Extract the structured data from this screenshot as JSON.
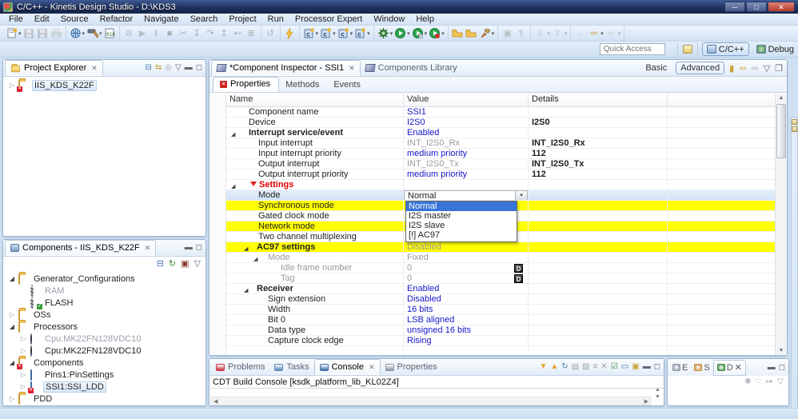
{
  "window": {
    "title": "C/C++ - Kinetis Design Studio - D:\\KDS3"
  },
  "menu": {
    "items": [
      "File",
      "Edit",
      "Source",
      "Refactor",
      "Navigate",
      "Search",
      "Project",
      "Run",
      "Processor Expert",
      "Window",
      "Help"
    ]
  },
  "toolbar": {
    "groups": [
      [
        {
          "n": "new-wizard",
          "dd": 1
        },
        {
          "n": "save",
          "dis": 1
        },
        {
          "n": "save-all",
          "dis": 1
        },
        {
          "n": "print",
          "dis": 1
        }
      ],
      [
        {
          "n": "debug-configurations",
          "dd": 1
        },
        {
          "n": "build",
          "dd": 1
        },
        {
          "n": "binary-utility"
        }
      ],
      [
        {
          "n": "skip-all-breakpoints",
          "dis": 1
        },
        {
          "n": "resume",
          "dis": 1
        },
        {
          "n": "suspend",
          "dis": 1
        },
        {
          "n": "terminate",
          "dis": 1
        },
        {
          "n": "disconnect",
          "dis": 1
        },
        {
          "n": "step-into",
          "dis": 1
        },
        {
          "n": "step-over",
          "dis": 1
        },
        {
          "n": "step-return",
          "dis": 1
        },
        {
          "n": "drop-to-frame",
          "dis": 1
        },
        {
          "n": "instruction-stepping",
          "dis": 1
        }
      ],
      [
        {
          "n": "restart",
          "dis": 1
        }
      ],
      [
        {
          "n": "flash-programmer"
        }
      ],
      [
        {
          "n": "new-connection",
          "dd": 1
        },
        {
          "n": "new-project",
          "dd": 1
        },
        {
          "n": "new-c-file",
          "dd": 1
        },
        {
          "n": "new-class",
          "dd": 1
        }
      ],
      [
        {
          "n": "debug",
          "dd": 1
        },
        {
          "n": "run",
          "dd": 1
        },
        {
          "n": "run-history",
          "dd": 1
        },
        {
          "n": "profile",
          "dd": 1
        }
      ],
      [
        {
          "n": "open-project"
        },
        {
          "n": "open-folder"
        },
        {
          "n": "search-toolbar",
          "dd": 1
        }
      ],
      [
        {
          "n": "mark-occurrences",
          "dis": 1
        },
        {
          "n": "show-whitespace",
          "dis": 1
        }
      ],
      [
        {
          "n": "next-annotation",
          "dis": 1,
          "dd": 1
        },
        {
          "n": "previous-annotation",
          "dis": 1,
          "dd": 1
        }
      ],
      [
        {
          "n": "last-edit-location",
          "dis": 1
        },
        {
          "n": "back",
          "dd": 1
        },
        {
          "n": "forward",
          "dis": 1,
          "dd": 1
        }
      ]
    ]
  },
  "quick_access": {
    "placeholder": "Quick Access"
  },
  "perspectives": {
    "items": [
      {
        "label": "C/C++",
        "active": true
      },
      {
        "label": "Debug",
        "active": false
      }
    ]
  },
  "project_explorer": {
    "title": "Project Explorer",
    "tree": [
      {
        "label": "IIS_KDS_K22F",
        "icon": "project",
        "level": 0,
        "arrow": "col",
        "selected": true
      }
    ]
  },
  "components_view": {
    "title": "Components - IIS_KDS_K22F",
    "tree": [
      {
        "label": "Generator_Configurations",
        "icon": "folder",
        "level": 0,
        "arrow": "exp"
      },
      {
        "label": "RAM",
        "icon": "gear",
        "level": 1,
        "gray": true
      },
      {
        "label": "FLASH",
        "icon": "gear-ok",
        "level": 1
      },
      {
        "label": "OSs",
        "icon": "folder",
        "level": 0,
        "arrow": "col"
      },
      {
        "label": "Processors",
        "icon": "folder",
        "level": 0,
        "arrow": "exp"
      },
      {
        "label": "Cpu:MK22FN128VDC10",
        "icon": "cpu",
        "level": 1,
        "arrow": "col",
        "gray": true
      },
      {
        "label": "Cpu:MK22FN128VDC10",
        "icon": "cpu",
        "level": 1,
        "arrow": "col"
      },
      {
        "label": "Components",
        "icon": "folder-err",
        "level": 0,
        "arrow": "exp"
      },
      {
        "label": "Pins1:PinSettings",
        "icon": "chip",
        "level": 1,
        "arrow": "col"
      },
      {
        "label": "SSI1:SSI_LDD",
        "icon": "chip-err",
        "level": 1,
        "arrow": "col",
        "selected": true
      },
      {
        "label": "PDD",
        "icon": "folder",
        "level": 0,
        "arrow": "col"
      }
    ]
  },
  "inspector": {
    "tab_label": "*Component Inspector - SSI1",
    "library_tab_label": "Components Library",
    "view_modes": [
      {
        "label": "Basic",
        "active": false
      },
      {
        "label": "Advanced",
        "active": true
      }
    ],
    "subtabs": [
      {
        "label": "Properties",
        "active": true,
        "error": true
      },
      {
        "label": "Methods"
      },
      {
        "label": "Events"
      }
    ],
    "columns": [
      "Name",
      "Value",
      "Details"
    ],
    "rows": [
      {
        "name": "Component name",
        "indent": 28,
        "value": "SSI1",
        "vstyle": "link"
      },
      {
        "name": "Device",
        "indent": 28,
        "value": "I2S0",
        "vstyle": "link",
        "details": "I2S0"
      },
      {
        "name": "Interrupt service/event",
        "indent": 28,
        "arrow": 6,
        "bold": true,
        "value": "Enabled",
        "vstyle": "link"
      },
      {
        "name": "Input interrupt",
        "indent": 40,
        "value": "INT_I2S0_Rx",
        "vstyle": "gray",
        "details": "INT_I2S0_Rx"
      },
      {
        "name": "Input interrupt priority",
        "indent": 40,
        "value": "medium priority",
        "vstyle": "link",
        "details": "112"
      },
      {
        "name": "Output interrupt",
        "indent": 40,
        "value": "INT_I2S0_Tx",
        "vstyle": "gray",
        "details": "INT_I2S0_Tx"
      },
      {
        "name": "Output interrupt priority",
        "indent": 40,
        "value": "medium priority",
        "vstyle": "link",
        "details": "112"
      },
      {
        "name": "Settings",
        "indent": 30,
        "arrow": 6,
        "red": true,
        "error": true
      },
      {
        "name": "Mode",
        "indent": 40,
        "selected": true,
        "combo": "Normal"
      },
      {
        "name": "Synchronous mode",
        "indent": 40,
        "yellow": true
      },
      {
        "name": "Gated clock mode",
        "indent": 40
      },
      {
        "name": "Network mode",
        "indent": 40,
        "yellow": true
      },
      {
        "name": "Two channel multiplexing",
        "indent": 40
      },
      {
        "name": "AC97 settings",
        "indent": 38,
        "arrow": 22,
        "bold": true,
        "yellow": true,
        "value": "Disabled",
        "vstyle": "gray"
      },
      {
        "name": "Mode",
        "indent": 52,
        "arrow": 34,
        "grayname": true,
        "value": "Fixed",
        "vstyle": "gray"
      },
      {
        "name": "Idle frame number",
        "indent": 68,
        "grayname": true,
        "value": "0",
        "vstyle": "gray",
        "dbtn": "D"
      },
      {
        "name": "Tag",
        "indent": 68,
        "grayname": true,
        "value": "0",
        "vstyle": "gray",
        "dbtn": "D"
      },
      {
        "name": "Receiver",
        "indent": 38,
        "arrow": 22,
        "bold": true,
        "value": "Enabled",
        "vstyle": "link"
      },
      {
        "name": "Sign extension",
        "indent": 52,
        "value": "Disabled",
        "vstyle": "link"
      },
      {
        "name": "Width",
        "indent": 52,
        "value": "16 bits",
        "vstyle": "link"
      },
      {
        "name": "Bit 0",
        "indent": 52,
        "value": "LSB aligned",
        "vstyle": "link"
      },
      {
        "name": "Data type",
        "indent": 52,
        "value": "unsigned 16 bits",
        "vstyle": "link"
      },
      {
        "name": "Capture clock edge",
        "indent": 52,
        "value": "Rising",
        "vstyle": "link"
      }
    ],
    "dropdown": {
      "options": [
        "Normal",
        "I2S master",
        "I2S slave",
        "[!] AC97"
      ],
      "selected_index": 0
    }
  },
  "console": {
    "tabs": [
      {
        "label": "Problems",
        "icon": "problems"
      },
      {
        "label": "Tasks",
        "icon": "tasks"
      },
      {
        "label": "Console",
        "icon": "console",
        "active": true
      },
      {
        "label": "Properties",
        "icon": "properties-view"
      }
    ],
    "content": "CDT Build Console [ksdk_platform_lib_KL02Z4]"
  },
  "minimized_views": {
    "tabs": [
      {
        "label": "E",
        "icon": "expressions"
      },
      {
        "label": "S",
        "icon": "search"
      },
      {
        "label": "D",
        "icon": "debug",
        "active": true
      }
    ]
  }
}
